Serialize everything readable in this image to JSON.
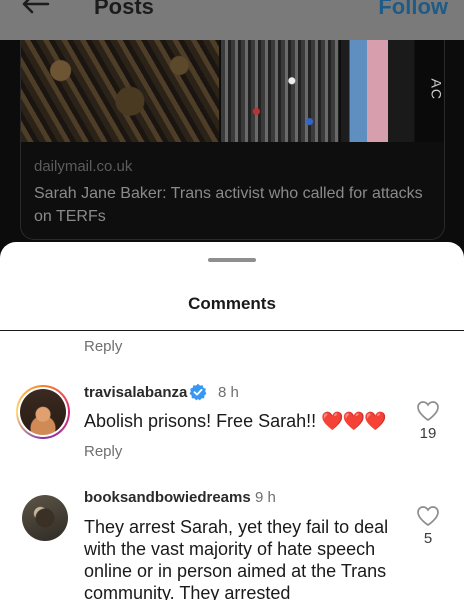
{
  "header": {
    "title": "Posts",
    "follow_label": "Follow"
  },
  "post": {
    "image_sign_text": "AC",
    "source": "dailymail.co.uk",
    "headline": "Sarah Jane Baker: Trans activist who called for attacks on TERFs"
  },
  "comments_sheet": {
    "title": "Comments",
    "reply_label": "Reply",
    "comments": [
      {
        "username": "travisalabanza",
        "verified": true,
        "time": "8 h",
        "text": "Abolish prisons! Free Sarah!!",
        "emoji": "❤️❤️❤️",
        "likes": "19",
        "reply_label": "Reply"
      },
      {
        "username": "booksandbowiedreams",
        "verified": false,
        "time": "9 h",
        "text": "They arrest Sarah, yet they fail to deal with the vast majority of hate speech online or in person aimed at the Trans community.  They arrested",
        "likes": "5"
      }
    ]
  },
  "icons": {
    "back": "back-arrow-icon",
    "like": "heart-outline-icon",
    "verified": "verified-badge-icon"
  },
  "colors": {
    "verified_blue": "#3897f0",
    "heart_red": "#d92f3f"
  }
}
